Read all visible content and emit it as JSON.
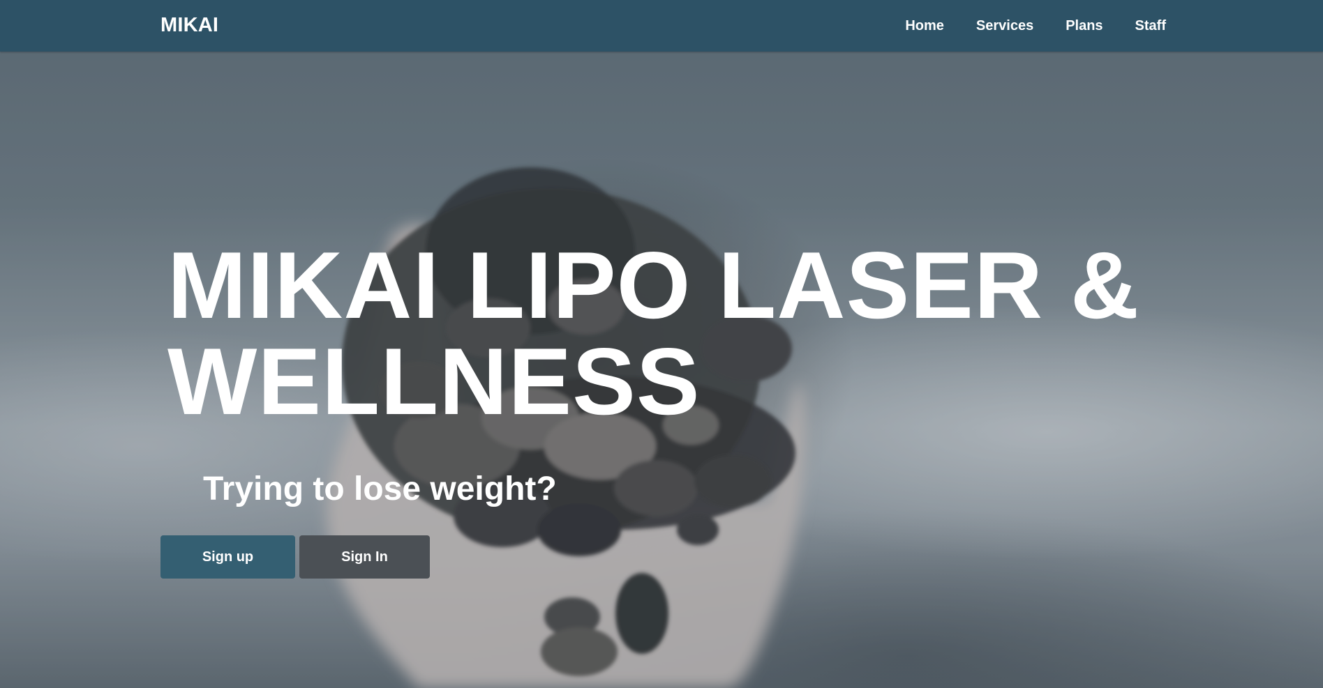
{
  "nav": {
    "brand": "MIKAI",
    "links": [
      {
        "label": "Home"
      },
      {
        "label": "Services"
      },
      {
        "label": "Plans"
      },
      {
        "label": "Staff"
      }
    ]
  },
  "hero": {
    "title": "MIKAI LIPO LASER & WELLNESS",
    "subtitle": "Trying to lose weight?",
    "signup_label": "Sign up",
    "signin_label": "Sign In",
    "background_image": "hand-holding-pebbles-image"
  },
  "colors": {
    "navbar": "#2d5266",
    "signup_button": "#345f72",
    "signin_button": "#4b5055",
    "text": "#ffffff"
  }
}
